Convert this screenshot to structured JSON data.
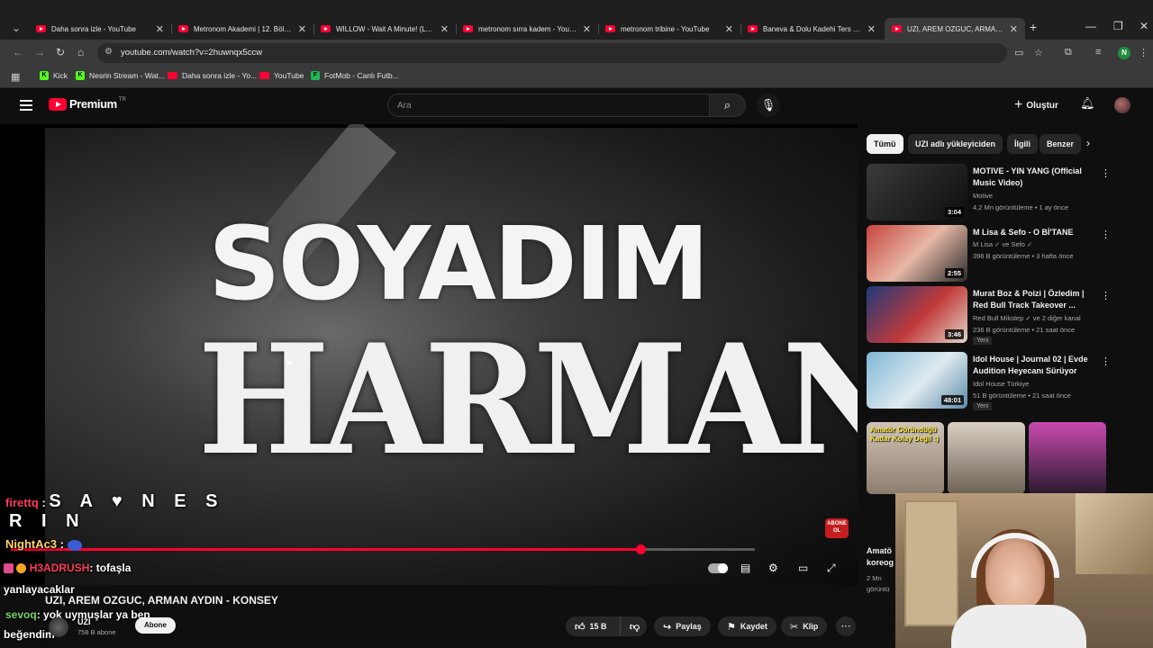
{
  "browser": {
    "tabs": [
      {
        "title": "Daha sonra izle - YouTube"
      },
      {
        "title": "Metronom Akademi | 12. Bölüm"
      },
      {
        "title": "WILLOW - Wait A Minute! (Lyric"
      },
      {
        "title": "metronom sırra kadem - YouTu"
      },
      {
        "title": "metronom tribine - YouTube"
      },
      {
        "title": "Baneva & Dolu Kadehi Ters Tut"
      },
      {
        "title": "UZI, AREM OZGUC, ARMAN AY"
      }
    ],
    "url": "youtube.com/watch?v=2huwnqx5ccw",
    "profile_initial": "N",
    "bookmarks": [
      {
        "label": "Kick",
        "color": "#53fc18",
        "glyph": "K"
      },
      {
        "label": "Nesrin Stream - Wat...",
        "color": "#53fc18",
        "glyph": "K"
      },
      {
        "label": "Daha sonra izle - Yo...",
        "color": "#ff0033",
        "glyph": ""
      },
      {
        "label": "YouTube",
        "color": "#ff0033",
        "glyph": ""
      },
      {
        "label": "FotMob - Canlı Futb...",
        "color": "#1db954",
        "glyph": "F"
      }
    ]
  },
  "youtube": {
    "logo_text": "Premium",
    "logo_sup": "TR",
    "search_placeholder": "Ara",
    "create_label": "Oluştur"
  },
  "video": {
    "overlay_line1": "SOYADIM",
    "overlay_line2": "HARMAN",
    "abone_badge": "ABONE OL",
    "progress": 0.846,
    "title": "UZI, AREM OZGUC, ARMAN AYDIN - KONSEY",
    "channel": "UZI",
    "subscribers": "758 B abone",
    "subscribe_label": "Abone ol",
    "likes": "15 B",
    "share_label": "Paylaş",
    "save_label": "Kaydet",
    "clip_label": "Klip"
  },
  "chat": [
    {
      "user": "firettq",
      "msg": "S A ♥ N E S"
    },
    {
      "user": "",
      "msg": "R I N"
    },
    {
      "user": "NightAc3",
      "msg": ""
    },
    {
      "user": "H3ADRUSH",
      "msg": ": tofaşla"
    },
    {
      "user": "",
      "msg": "yanlayacaklar"
    },
    {
      "user": "sevoq",
      "msg": ": yok uymuşlar ya ben"
    },
    {
      "user": "",
      "msg": "beğendim"
    }
  ],
  "sidebar": {
    "chips": [
      "Tümü",
      "UZI adlı yükleyiciden",
      "İlgili",
      "Benzer"
    ],
    "recommendations": [
      {
        "title": "MOTIVE - YIN YANG (Official Music Video)",
        "channel": "Motive",
        "stats": "4,2 Mn görüntüleme • 1 ay önce",
        "duration": "3:04",
        "badge": ""
      },
      {
        "title": "M Lisa & Sefo - O Bİ'TANE",
        "channel": "M Lisa ✓ ve Sefo ✓",
        "stats": "396 B görüntüleme • 3 hafta önce",
        "duration": "2:55",
        "badge": ""
      },
      {
        "title": "Murat Boz & Poizi | Özledim | Red Bull Track Takeover ...",
        "channel": "Red Bull Mikstep ✓ ve 2 diğer kanal",
        "stats": "236 B görüntüleme • 21 saat önce",
        "duration": "3:46",
        "badge": "Yeni"
      },
      {
        "title": "Idol House | Journal 02 | Evde Audition Heyecanı Sürüyor",
        "channel": "Idol House Türkiye",
        "stats": "51 B görüntüleme • 21 saat önce",
        "duration": "48:01",
        "badge": "Yeni"
      }
    ],
    "shorts_text": "Amatör Göründüğü Kadar Kolay Değil :)",
    "partial_title": "Amatö\nkoreog",
    "partial_meta": "2 Mn\ngörüntü"
  },
  "colors": {
    "accent": "#ff0033",
    "background": "#0f0f0f",
    "chat_user": "#ff3b5c"
  }
}
